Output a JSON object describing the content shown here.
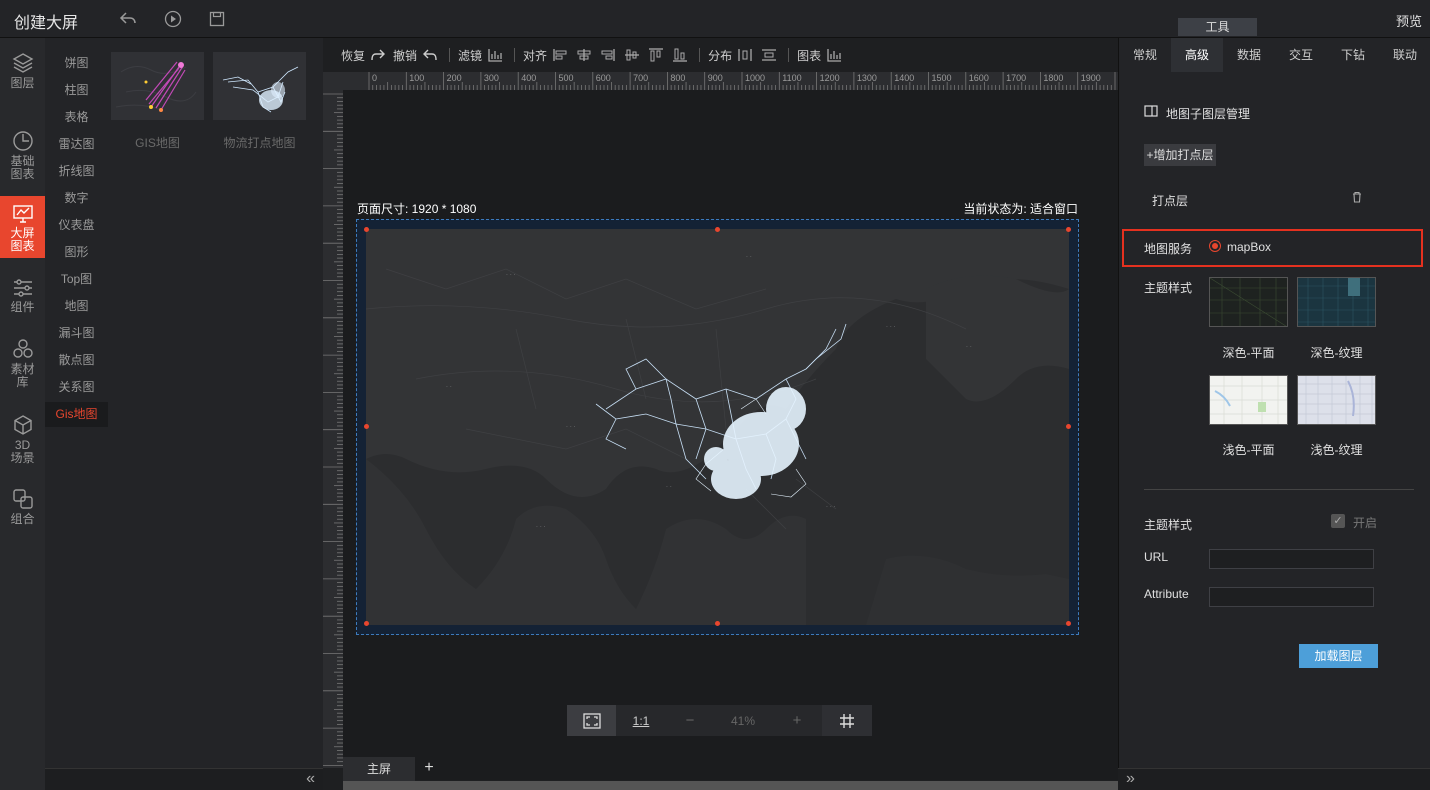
{
  "app": {
    "title": "创建大屏",
    "preview": "预览",
    "tools_tab": "工具"
  },
  "iconbar": [
    {
      "label1": "图层",
      "label2": "",
      "icon": "layers-icon"
    },
    {
      "label1": "基础",
      "label2": "图表",
      "icon": "clock-chart-icon"
    },
    {
      "label1": "大屏",
      "label2": "图表",
      "icon": "screen-chart-icon"
    },
    {
      "label1": "组件",
      "label2": "",
      "icon": "sliders-icon"
    },
    {
      "label1": "素材",
      "label2": "库",
      "icon": "material-icon"
    },
    {
      "label1": "3D",
      "label2": "场景",
      "icon": "cube-icon"
    },
    {
      "label1": "组合",
      "label2": "",
      "icon": "combine-icon"
    }
  ],
  "categories": [
    "饼图",
    "柱图",
    "表格",
    "雷达图",
    "折线图",
    "数字",
    "仪表盘",
    "图形",
    "Top图",
    "地图",
    "漏斗图",
    "散点图",
    "关系图",
    "Gis地图"
  ],
  "thumbnails": [
    {
      "label": "GIS地图"
    },
    {
      "label": "物流打点地图"
    }
  ],
  "toolbar": {
    "restore": "恢复",
    "undo": "撤销",
    "filter": "滤镜",
    "align": "对齐",
    "distribute": "分布",
    "chart": "图表"
  },
  "ruler_labels": [
    "0",
    "100",
    "200",
    "300",
    "400",
    "500",
    "600",
    "700",
    "800",
    "900",
    "1000",
    "1100",
    "1200",
    "1300",
    "1400",
    "1500",
    "1600",
    "1700",
    "1800",
    "1900"
  ],
  "canvas": {
    "page_size": "页面尺寸: 1920 * 1080",
    "current_status": "当前状态为: 适合窗口"
  },
  "zoom": {
    "one_to_one": "1:1",
    "minus": "−",
    "value": "41%",
    "plus": "+"
  },
  "bottom": {
    "screen_tab": "主屏",
    "add": "+"
  },
  "right": {
    "tabs": [
      "常规",
      "高级",
      "数据",
      "交互",
      "下钻",
      "联动"
    ],
    "sublayer_manage": "地图子图层管理",
    "add_point_layer": "+增加打点层",
    "point_layer": "打点层",
    "map_service": "地图服务",
    "map_service_option": "mapBox",
    "theme_style": "主题样式",
    "styles": [
      "深色-平面",
      "深色-纹理",
      "浅色-平面",
      "浅色-纹理"
    ],
    "theme_style2": "主题样式",
    "enable": "开启",
    "url_label": "URL",
    "attribute_label": "Attribute",
    "load_layer": "加载图层"
  },
  "colors": {
    "accent": "#e8462e",
    "primary_button": "#4d9fd9",
    "highlight": "#e5311f"
  }
}
